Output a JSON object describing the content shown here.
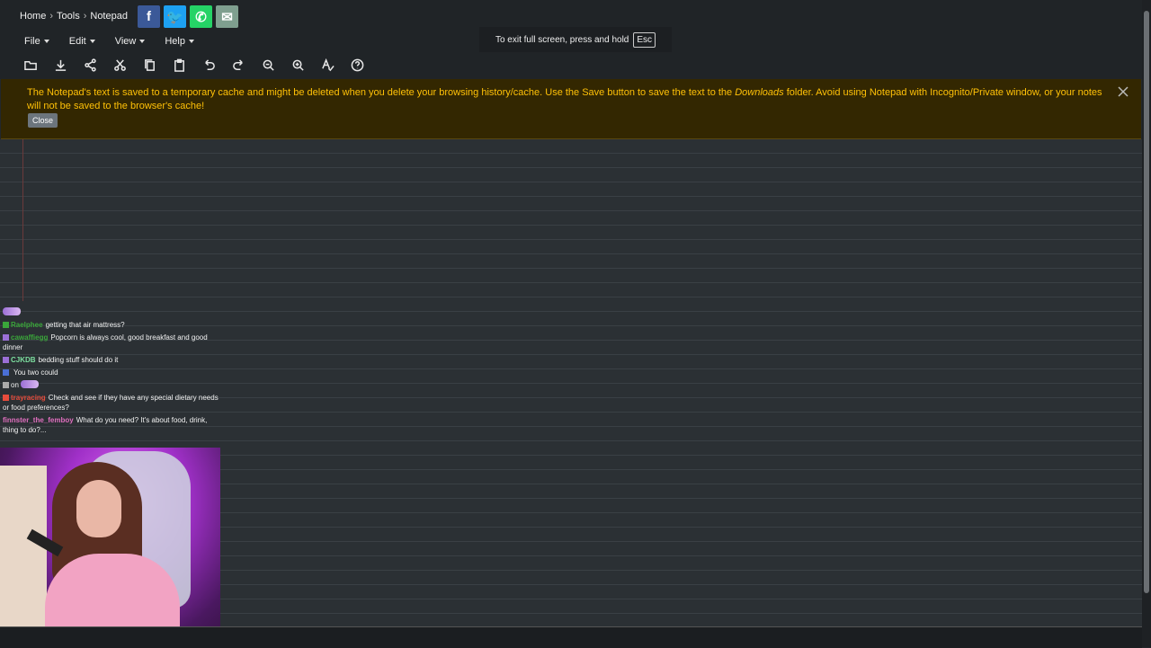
{
  "breadcrumb": [
    "Home",
    "Tools",
    "Notepad"
  ],
  "breadcrumb_separator": "›",
  "share": {
    "facebook": "f",
    "twitter": "t",
    "whatsapp": "w",
    "email": "e"
  },
  "menu": {
    "file": "File",
    "edit": "Edit",
    "view": "View",
    "help": "Help"
  },
  "toolbar_icons": [
    "open-icon",
    "download-icon",
    "share-icon",
    "cut-icon",
    "copy-icon",
    "paste-icon",
    "undo-icon",
    "redo-icon",
    "zoom-out-icon",
    "zoom-in-icon",
    "spellcheck-icon",
    "help-icon"
  ],
  "fullscreen_toast": {
    "text": "To exit full screen, press and hold",
    "key": "Esc"
  },
  "alert": {
    "text_before": "The Notepad's text is saved to a temporary cache and might be deleted when you delete your browsing history/cache. Use the Save button to save the text to the ",
    "emphasis": "Downloads",
    "text_after": " folder. Avoid using Notepad with Incognito/Private window, or your notes will not be saved to the browser's cache!",
    "close_label": "Close"
  },
  "chat": [
    {
      "nick": "Raelphee",
      "color": "#3aa63a",
      "message": "getting that air mattress?"
    },
    {
      "nick": "cawaffiegg",
      "color": "#3aa63a",
      "message": "Popcorn is always cool, good breakfast and good dinner"
    },
    {
      "nick": "CJKDB",
      "color": "#7de0a0",
      "message": "bedding stuff should do it"
    },
    {
      "nick": "",
      "color": "#c0392b",
      "message": "You two could"
    },
    {
      "nick": "",
      "color": "#cccccc",
      "message": "on"
    },
    {
      "nick": "trayracing",
      "color": "#e74c3c",
      "message": "Check and see if they have any special dietary needs or food preferences?"
    },
    {
      "nick": "finnster_the_femboy",
      "color": "#e06fbf",
      "message": "What do you need? It's about food, drink, thing to do?..."
    }
  ],
  "colors": {
    "alert_text": "#ffc107",
    "alert_bg": "#332701",
    "paper": "#2b3034"
  }
}
